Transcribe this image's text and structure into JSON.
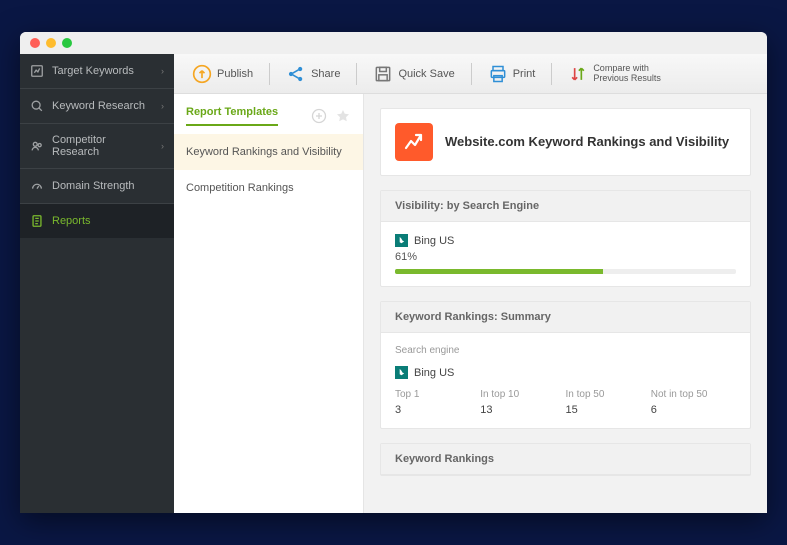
{
  "sidebar": {
    "items": [
      {
        "label": "Target Keywords",
        "icon": "chart"
      },
      {
        "label": "Keyword Research",
        "icon": "search"
      },
      {
        "label": "Competitor Research",
        "icon": "people"
      },
      {
        "label": "Domain Strength",
        "icon": "gauge"
      },
      {
        "label": "Reports",
        "icon": "doc",
        "active": true
      }
    ]
  },
  "toolbar": {
    "publish": "Publish",
    "share": "Share",
    "quicksave": "Quick Save",
    "print": "Print",
    "compare_line1": "Compare with",
    "compare_line2": "Previous Results"
  },
  "templates": {
    "title": "Report Templates",
    "items": [
      {
        "label": "Keyword Rankings and Visibility",
        "active": true
      },
      {
        "label": "Competition Rankings"
      }
    ]
  },
  "report": {
    "header_title": "Website.com Keyword Rankings and Visibility",
    "visibility": {
      "title": "Visibility: by Search Engine",
      "engine": "Bing US",
      "percent": "61%",
      "percent_val": 61
    },
    "summary": {
      "title": "Keyword Rankings: Summary",
      "sub": "Search engine",
      "engine": "Bing US",
      "cols": [
        {
          "label": "Top 1",
          "val": "3"
        },
        {
          "label": "In top 10",
          "val": "13"
        },
        {
          "label": "In top 50",
          "val": "15"
        },
        {
          "label": "Not in top 50",
          "val": "6"
        }
      ]
    },
    "rankings": {
      "title": "Keyword Rankings"
    }
  }
}
